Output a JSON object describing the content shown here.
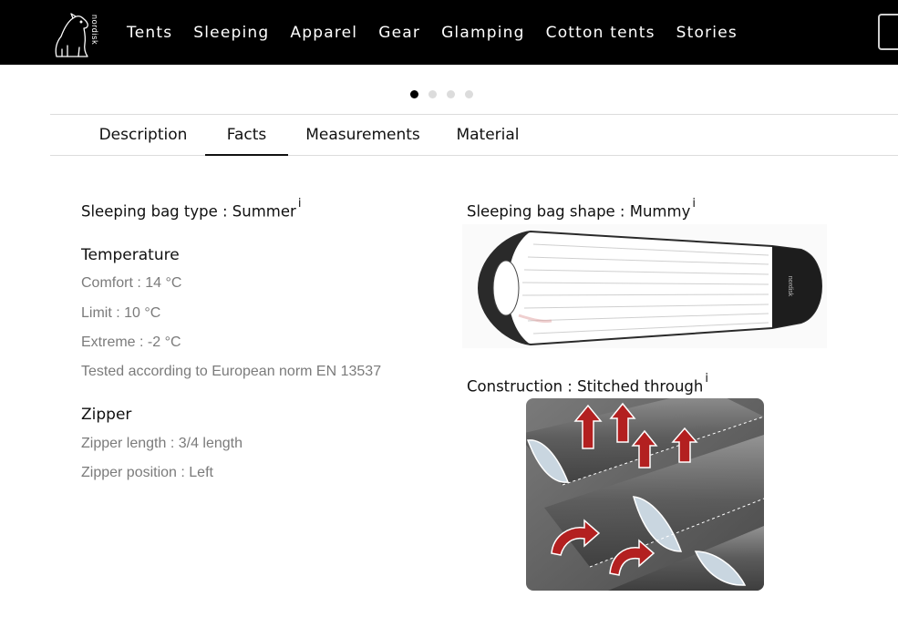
{
  "brand": {
    "logo_text": "nordisk"
  },
  "nav": {
    "items": [
      "Tents",
      "Sleeping",
      "Apparel",
      "Gear",
      "Glamping",
      "Cotton tents",
      "Stories"
    ]
  },
  "carousel": {
    "slide_count": 4,
    "active_index": 0
  },
  "tabs": {
    "items": [
      {
        "label": "Description",
        "active": false
      },
      {
        "label": "Facts",
        "active": true
      },
      {
        "label": "Measurements",
        "active": false
      },
      {
        "label": "Material",
        "active": false
      }
    ]
  },
  "facts": {
    "info_glyph": "i",
    "type": "Sleeping bag type : Summer",
    "temperature": {
      "heading": "Temperature",
      "comfort": "Comfort : 14 °C",
      "limit": "Limit : 10 °C",
      "extreme": "Extreme : -2 °C",
      "norm": "Tested according to European norm EN 13537"
    },
    "zipper": {
      "heading": "Zipper",
      "length": "Zipper length : 3/4 length",
      "position": "Zipper position : Left"
    },
    "shape": "Sleeping bag shape : Mummy",
    "construction": "Construction : Stitched through"
  },
  "colors": {
    "header_bg": "#000000",
    "fact_value": "#7b7b7b",
    "accent_red": "#b32020"
  }
}
